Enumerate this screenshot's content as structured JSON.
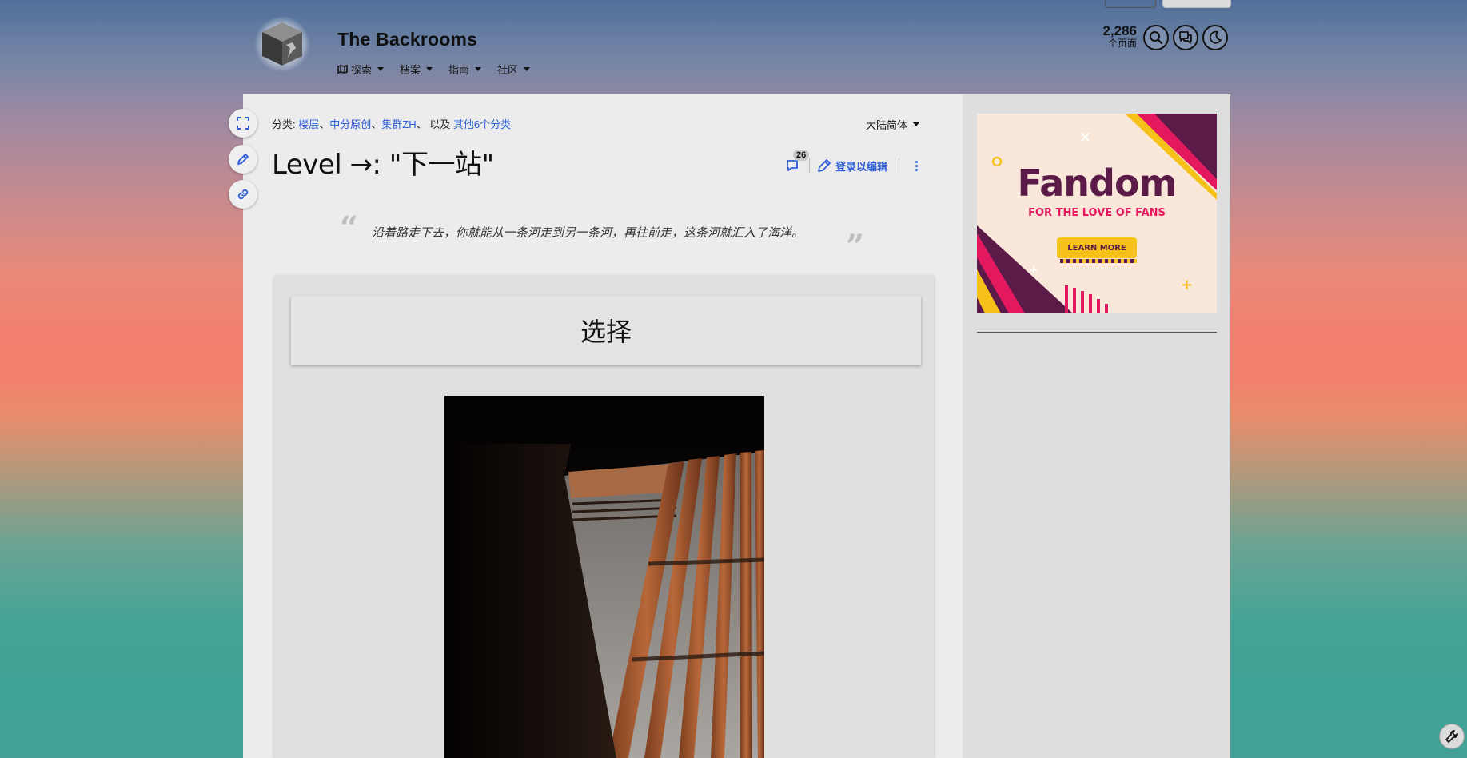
{
  "site": {
    "title": "The Backrooms",
    "nav": [
      {
        "label": "探索"
      },
      {
        "label": "档案"
      },
      {
        "label": "指南"
      },
      {
        "label": "社区"
      }
    ],
    "page_count": "2,286",
    "page_count_label": "个页面"
  },
  "article": {
    "categories_prefix": "分类: ",
    "categories": [
      "楼层",
      "中分原创",
      "集群ZH"
    ],
    "categories_and": "以及",
    "categories_more": "其他6个分类",
    "language": "大陆简体",
    "title": "Level →: \"下一站\"",
    "comment_count": "26",
    "edit_label": "登录以编辑",
    "quote": "沿着路走下去，你就能从一条河走到另一条河，再往前走，这条河就汇入了海洋。",
    "choice_label": "选择"
  },
  "ad": {
    "brand": "Fandom",
    "tagline": "FOR THE LOVE OF FANS",
    "cta": "LEARN MORE"
  },
  "colors": {
    "link": "#2d5bd6",
    "ad_brand": "#5b1a47",
    "ad_pink": "#e4185f",
    "ad_yellow": "#f6c21a"
  }
}
